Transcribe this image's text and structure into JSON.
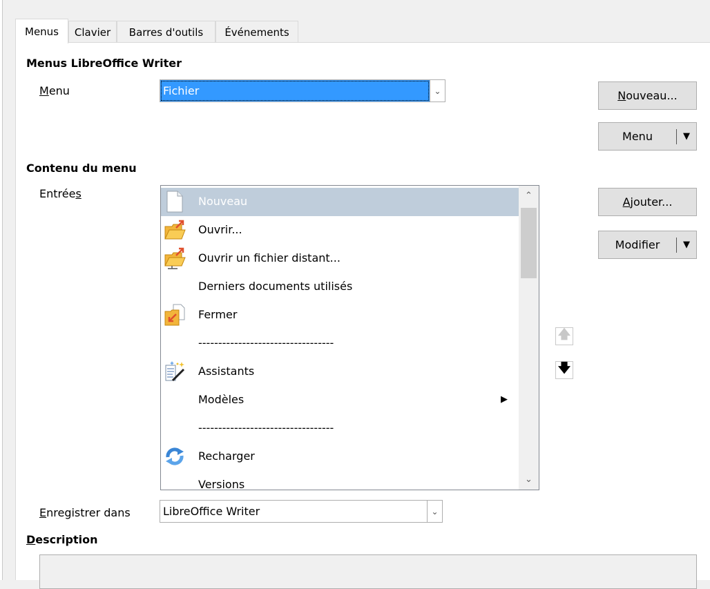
{
  "tabs": [
    "Menus",
    "Clavier",
    "Barres d'outils",
    "Événements"
  ],
  "section_menus": "Menus LibreOffice Writer",
  "menu_label": "Menu",
  "menu_value": "Fichier",
  "buttons": {
    "nouveau": "Nouveau...",
    "menu": "Menu",
    "ajouter": "Ajouter...",
    "modifier": "Modifier"
  },
  "section_content": "Contenu du menu",
  "entries_label": "Entrées",
  "entries": [
    {
      "label": "Nouveau",
      "icon": "blank-document-icon",
      "selected": true
    },
    {
      "label": "Ouvrir...",
      "icon": "open-folder-icon"
    },
    {
      "label": "Ouvrir un fichier distant...",
      "icon": "remote-folder-icon"
    },
    {
      "label": "Derniers documents utilisés",
      "icon": ""
    },
    {
      "label": "Fermer",
      "icon": "close-document-icon"
    },
    {
      "label": "----------------------------------",
      "icon": ""
    },
    {
      "label": "Assistants",
      "icon": "wizard-icon"
    },
    {
      "label": "Modèles",
      "icon": "",
      "submenu": true
    },
    {
      "label": "----------------------------------",
      "icon": ""
    },
    {
      "label": "Recharger",
      "icon": "reload-icon"
    },
    {
      "label": "Versions",
      "icon": ""
    }
  ],
  "save_in_label": "Enregistrer dans",
  "save_in_value": "LibreOffice Writer",
  "description_label": "Description",
  "colors": {
    "selection": "#3399ff",
    "list_selected": "#bfcddb",
    "window_bg": "#f0f0f0"
  }
}
